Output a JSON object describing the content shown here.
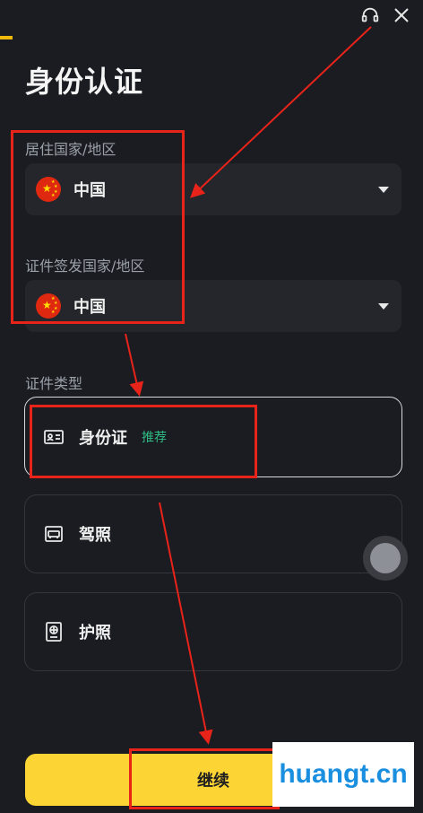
{
  "header": {
    "support_icon": "headset-icon",
    "close_icon": "close-icon"
  },
  "page": {
    "title": "身份认证"
  },
  "residence": {
    "label": "居住国家/地区",
    "value": "中国",
    "flag_icon": "china-flag-icon"
  },
  "issuing": {
    "label": "证件签发国家/地区",
    "value": "中国",
    "flag_icon": "china-flag-icon"
  },
  "id_type": {
    "label": "证件类型",
    "options": [
      {
        "label": "身份证",
        "badge": "推荐",
        "icon": "id-card-icon",
        "selected": true
      },
      {
        "label": "驾照",
        "icon": "driver-license-icon",
        "selected": false
      },
      {
        "label": "护照",
        "icon": "passport-icon",
        "selected": false
      }
    ]
  },
  "actions": {
    "continue_label": "继续"
  },
  "watermark": {
    "text": "huangt.cn"
  },
  "colors": {
    "accent": "#fcd535",
    "annotation": "#e8231a",
    "recommend": "#2ebd85",
    "background": "#1b1c21"
  }
}
